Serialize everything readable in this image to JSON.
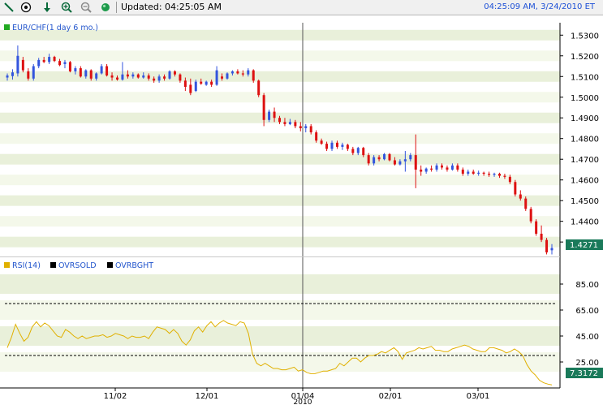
{
  "toolbar": {
    "updated_label": "Updated: 04:25:05 AM",
    "timestamp": "04:25:09 AM, 3/24/2010 ET",
    "icons": [
      "draw-line-icon",
      "crosshair-icon",
      "arrow-down-icon",
      "zoom-in-icon",
      "zoom-out-icon",
      "green-dot-icon"
    ]
  },
  "colors": {
    "up_candle": "#3355dd",
    "down_candle": "#dd1111",
    "rsi_line": "#e0b000",
    "last_price_tag": "#1a7a5a",
    "band_light": "#f4f8ea",
    "band_dark": "#e9f0da"
  },
  "chart_data": [
    {
      "type": "candlestick",
      "title": "EUR/CHF(1 day 6 mo.)",
      "legend_swatch_color": "#22aa22",
      "ylim": [
        1.423,
        1.536
      ],
      "y_ticks": [
        "1.5300",
        "1.5200",
        "1.5100",
        "1.5000",
        "1.4900",
        "1.4800",
        "1.4700",
        "1.4600",
        "1.4500",
        "1.4400",
        "1.4300"
      ],
      "last_price": "1.4271",
      "ohlc": [
        [
          1.5095,
          1.5115,
          1.508,
          1.5105
        ],
        [
          1.5102,
          1.5135,
          1.5085,
          1.512
        ],
        [
          1.5115,
          1.525,
          1.51,
          1.52
        ],
        [
          1.518,
          1.5195,
          1.512,
          1.513
        ],
        [
          1.5125,
          1.514,
          1.508,
          1.509
        ],
        [
          1.509,
          1.516,
          1.508,
          1.515
        ],
        [
          1.515,
          1.519,
          1.514,
          1.518
        ],
        [
          1.518,
          1.5195,
          1.5165,
          1.517
        ],
        [
          1.517,
          1.521,
          1.516,
          1.5195
        ],
        [
          1.5195,
          1.52,
          1.517,
          1.5175
        ],
        [
          1.5175,
          1.5185,
          1.515,
          1.5155
        ],
        [
          1.516,
          1.518,
          1.514,
          1.517
        ],
        [
          1.517,
          1.5175,
          1.512,
          1.5125
        ],
        [
          1.5125,
          1.515,
          1.511,
          1.514
        ],
        [
          1.514,
          1.515,
          1.5095,
          1.51
        ],
        [
          1.51,
          1.5135,
          1.509,
          1.513
        ],
        [
          1.513,
          1.5135,
          1.508,
          1.509
        ],
        [
          1.509,
          1.512,
          1.508,
          1.5115
        ],
        [
          1.5115,
          1.516,
          1.511,
          1.515
        ],
        [
          1.515,
          1.516,
          1.51,
          1.5105
        ],
        [
          1.5105,
          1.512,
          1.508,
          1.5095
        ],
        [
          1.5095,
          1.5105,
          1.508,
          1.5085
        ],
        [
          1.5085,
          1.517,
          1.508,
          1.511
        ],
        [
          1.511,
          1.513,
          1.509,
          1.51
        ],
        [
          1.51,
          1.512,
          1.509,
          1.511
        ],
        [
          1.511,
          1.5115,
          1.509,
          1.5095
        ],
        [
          1.5095,
          1.512,
          1.509,
          1.5105
        ],
        [
          1.5105,
          1.5115,
          1.508,
          1.509
        ],
        [
          1.509,
          1.51,
          1.507,
          1.508
        ],
        [
          1.508,
          1.511,
          1.507,
          1.51
        ],
        [
          1.51,
          1.511,
          1.508,
          1.509
        ],
        [
          1.509,
          1.513,
          1.5085,
          1.5125
        ],
        [
          1.5125,
          1.513,
          1.51,
          1.511
        ],
        [
          1.511,
          1.5115,
          1.507,
          1.508
        ],
        [
          1.508,
          1.5095,
          1.503,
          1.505
        ],
        [
          1.506,
          1.509,
          1.501,
          1.502
        ],
        [
          1.503,
          1.5085,
          1.5025,
          1.5075
        ],
        [
          1.5075,
          1.509,
          1.506,
          1.5065
        ],
        [
          1.506,
          1.508,
          1.5055,
          1.5075
        ],
        [
          1.5075,
          1.5085,
          1.505,
          1.506
        ],
        [
          1.506,
          1.515,
          1.5055,
          1.513
        ],
        [
          1.51,
          1.5115,
          1.508,
          1.509
        ],
        [
          1.509,
          1.512,
          1.5085,
          1.5115
        ],
        [
          1.5115,
          1.513,
          1.5105,
          1.5125
        ],
        [
          1.5125,
          1.5135,
          1.511,
          1.5115
        ],
        [
          1.5115,
          1.513,
          1.51,
          1.511
        ],
        [
          1.511,
          1.514,
          1.51,
          1.513
        ],
        [
          1.513,
          1.5135,
          1.507,
          1.508
        ],
        [
          1.508,
          1.5085,
          1.5,
          1.501
        ],
        [
          1.501,
          1.502,
          1.486,
          1.489
        ],
        [
          1.489,
          1.494,
          1.488,
          1.493
        ],
        [
          1.493,
          1.495,
          1.488,
          1.49
        ],
        [
          1.49,
          1.491,
          1.487,
          1.488
        ],
        [
          1.488,
          1.49,
          1.486,
          1.487
        ],
        [
          1.487,
          1.4895,
          1.4865,
          1.488
        ],
        [
          1.488,
          1.489,
          1.485,
          1.486
        ],
        [
          1.486,
          1.488,
          1.4835,
          1.485
        ],
        [
          1.485,
          1.487,
          1.483,
          1.486
        ],
        [
          1.486,
          1.487,
          1.482,
          1.483
        ],
        [
          1.483,
          1.484,
          1.478,
          1.479
        ],
        [
          1.479,
          1.48,
          1.477,
          1.4775
        ],
        [
          1.4775,
          1.4785,
          1.474,
          1.475
        ],
        [
          1.475,
          1.479,
          1.474,
          1.478
        ],
        [
          1.478,
          1.479,
          1.475,
          1.476
        ],
        [
          1.476,
          1.478,
          1.4745,
          1.477
        ],
        [
          1.477,
          1.4775,
          1.474,
          1.475
        ],
        [
          1.475,
          1.476,
          1.472,
          1.473
        ],
        [
          1.473,
          1.476,
          1.472,
          1.4755
        ],
        [
          1.4755,
          1.476,
          1.471,
          1.472
        ],
        [
          1.472,
          1.473,
          1.467,
          1.468
        ],
        [
          1.468,
          1.472,
          1.467,
          1.471
        ],
        [
          1.471,
          1.472,
          1.469,
          1.47
        ],
        [
          1.47,
          1.473,
          1.4695,
          1.4725
        ],
        [
          1.4725,
          1.473,
          1.469,
          1.4695
        ],
        [
          1.4695,
          1.471,
          1.467,
          1.4675
        ],
        [
          1.4675,
          1.47,
          1.467,
          1.469
        ],
        [
          1.469,
          1.474,
          1.464,
          1.47
        ],
        [
          1.47,
          1.473,
          1.469,
          1.472
        ],
        [
          1.472,
          1.482,
          1.456,
          1.465
        ],
        [
          1.465,
          1.467,
          1.462,
          1.464
        ],
        [
          1.464,
          1.466,
          1.463,
          1.4655
        ],
        [
          1.4655,
          1.467,
          1.464,
          1.465
        ],
        [
          1.465,
          1.468,
          1.464,
          1.467
        ],
        [
          1.467,
          1.468,
          1.465,
          1.466
        ],
        [
          1.466,
          1.467,
          1.464,
          1.465
        ],
        [
          1.465,
          1.468,
          1.4645,
          1.467
        ],
        [
          1.467,
          1.468,
          1.464,
          1.465
        ],
        [
          1.465,
          1.466,
          1.462,
          1.463
        ],
        [
          1.463,
          1.465,
          1.462,
          1.464
        ],
        [
          1.464,
          1.465,
          1.4625,
          1.463
        ],
        [
          1.463,
          1.4645,
          1.462,
          1.4635
        ],
        [
          1.4635,
          1.464,
          1.462,
          1.463
        ],
        [
          1.463,
          1.464,
          1.4615,
          1.4625
        ],
        [
          1.4625,
          1.4635,
          1.4615,
          1.463
        ],
        [
          1.463,
          1.4635,
          1.461,
          1.462
        ],
        [
          1.462,
          1.463,
          1.4605,
          1.4615
        ],
        [
          1.4615,
          1.4625,
          1.458,
          1.459
        ],
        [
          1.459,
          1.46,
          1.452,
          1.453
        ],
        [
          1.453,
          1.455,
          1.45,
          1.451
        ],
        [
          1.451,
          1.452,
          1.445,
          1.446
        ],
        [
          1.446,
          1.447,
          1.439,
          1.44
        ],
        [
          1.44,
          1.441,
          1.433,
          1.434
        ],
        [
          1.434,
          1.438,
          1.43,
          1.431
        ],
        [
          1.431,
          1.432,
          1.424,
          1.425
        ],
        [
          1.426,
          1.429,
          1.424,
          1.4271
        ]
      ]
    },
    {
      "type": "line",
      "title": "RSI(14)",
      "legend": [
        {
          "name": "RSI(14)",
          "color": "#e0b000"
        },
        {
          "name": "OVRSOLD",
          "color": "#000000"
        },
        {
          "name": "OVRBGHT",
          "color": "#000000"
        }
      ],
      "ylim": [
        0,
        100
      ],
      "y_ticks": [
        "85.00",
        "65.00",
        "45.00",
        "25.00"
      ],
      "overbought": 70,
      "oversold": 30,
      "last_value": "7.3172",
      "values": [
        36,
        44,
        54,
        47,
        41,
        44,
        52,
        56,
        52,
        55,
        53,
        49,
        45,
        44,
        50,
        48,
        45,
        43,
        45,
        43,
        44,
        45,
        45,
        46,
        44,
        45,
        47,
        46,
        45,
        43,
        45,
        44,
        44,
        45,
        43,
        48,
        52,
        51,
        50,
        47,
        50,
        47,
        41,
        38,
        42,
        49,
        52,
        48,
        53,
        56,
        52,
        55,
        57,
        55,
        54,
        53,
        56,
        55,
        47,
        31,
        24,
        22,
        24,
        22,
        20,
        20,
        19,
        19,
        20,
        21,
        18,
        19,
        17,
        16,
        16,
        17,
        18,
        18,
        19,
        20,
        24,
        22,
        25,
        28,
        28,
        25,
        28,
        30,
        30,
        31,
        33,
        32,
        34,
        36,
        33,
        27,
        32,
        33,
        34,
        36,
        35,
        36,
        37,
        34,
        34,
        33,
        33,
        35,
        36,
        37,
        38,
        37,
        35,
        34,
        33,
        33,
        36,
        36,
        35,
        34,
        32,
        33,
        35,
        33,
        30,
        23,
        18,
        15,
        11,
        9,
        8,
        7.3
      ]
    }
  ],
  "x_axis": {
    "tick_labels": [
      "11/02",
      "12/01",
      "01/04",
      "02/01",
      "03/01"
    ],
    "year_label": "2010"
  }
}
